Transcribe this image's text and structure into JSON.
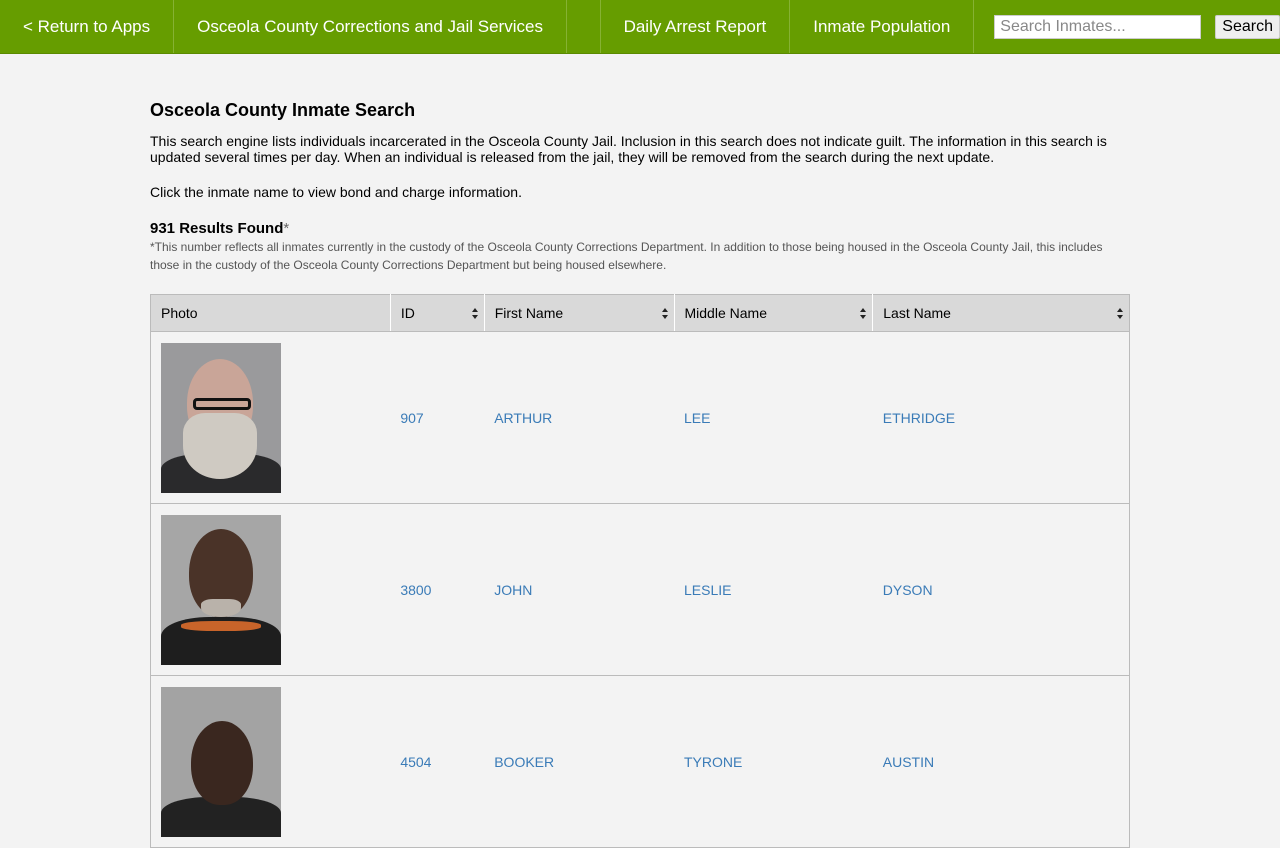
{
  "nav": {
    "return_label": "< Return to Apps",
    "site_title": "Osceola County Corrections and Jail Services",
    "daily_arrest": "Daily Arrest Report",
    "inmate_population": "Inmate Population",
    "search_placeholder": "Search Inmates...",
    "search_button": "Search"
  },
  "page": {
    "title": "Osceola County Inmate Search",
    "intro": "This search engine lists individuals incarcerated in the Osceola County Jail. Inclusion in this search does not indicate guilt. The information in this search is updated several times per day. When an individual is released from the jail, they will be removed from the search during the next update.",
    "click_note": "Click the inmate name to view bond and charge information.",
    "results_count": "931 Results Found",
    "results_asterisk": "*",
    "footnote": "*This number reflects all inmates currently in the custody of the Osceola County Corrections Department. In addition to those being housed in the Osceola County Jail, this includes those in the custody of the Osceola County Corrections Department but being housed elsewhere."
  },
  "table": {
    "headers": {
      "photo": "Photo",
      "id": "ID",
      "first": "First Name",
      "middle": "Middle Name",
      "last": "Last Name"
    },
    "rows": [
      {
        "id": "907",
        "first": "ARTHUR",
        "middle": "LEE",
        "last": "ETHRIDGE"
      },
      {
        "id": "3800",
        "first": "JOHN",
        "middle": "LESLIE",
        "last": "DYSON"
      },
      {
        "id": "4504",
        "first": "BOOKER",
        "middle": "TYRONE",
        "last": "AUSTIN"
      }
    ]
  },
  "colors": {
    "nav_bg": "#669d00",
    "link": "#3a7bb7",
    "header_bg": "#d9d9d9",
    "page_bg": "#f3f3f3"
  }
}
